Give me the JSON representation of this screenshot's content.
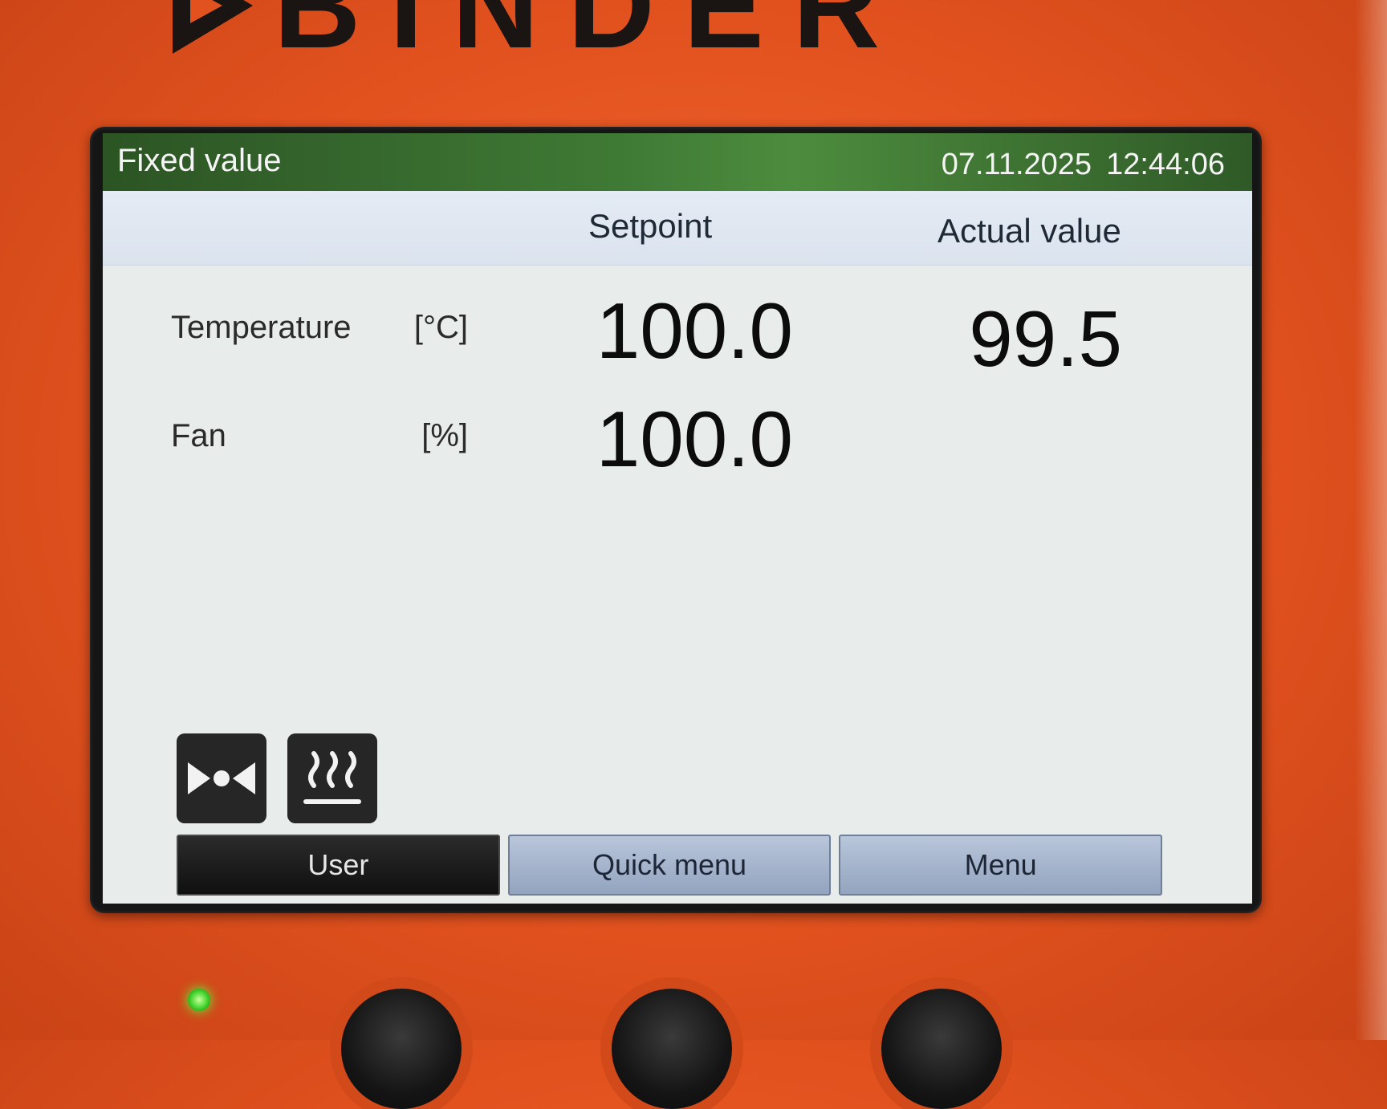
{
  "brand": {
    "name": "BINDER",
    "logo_icon": "binder-triangle-logo-icon"
  },
  "screen": {
    "title": "Fixed value",
    "date": "07.11.2025",
    "time": "12:44:06",
    "columns": {
      "setpoint": "Setpoint",
      "actual": "Actual value"
    },
    "rows": [
      {
        "label": "Temperature",
        "unit": "[°C]",
        "setpoint": "100.0",
        "actual": "99.5"
      },
      {
        "label": "Fan",
        "unit": "[%]",
        "setpoint": "100.0",
        "actual": ""
      }
    ],
    "status_icons": [
      "door-closed-icon",
      "heating-icon"
    ],
    "softkeys": {
      "user": "User",
      "quick_menu": "Quick menu",
      "menu": "Menu"
    }
  },
  "colors": {
    "housing": "#e2521f",
    "title_bar": "#3f7a35",
    "screen_bg": "#e8eceb",
    "softkey_active": "#101010",
    "softkey": "#a9b7cd",
    "led": "#3fd12a"
  }
}
